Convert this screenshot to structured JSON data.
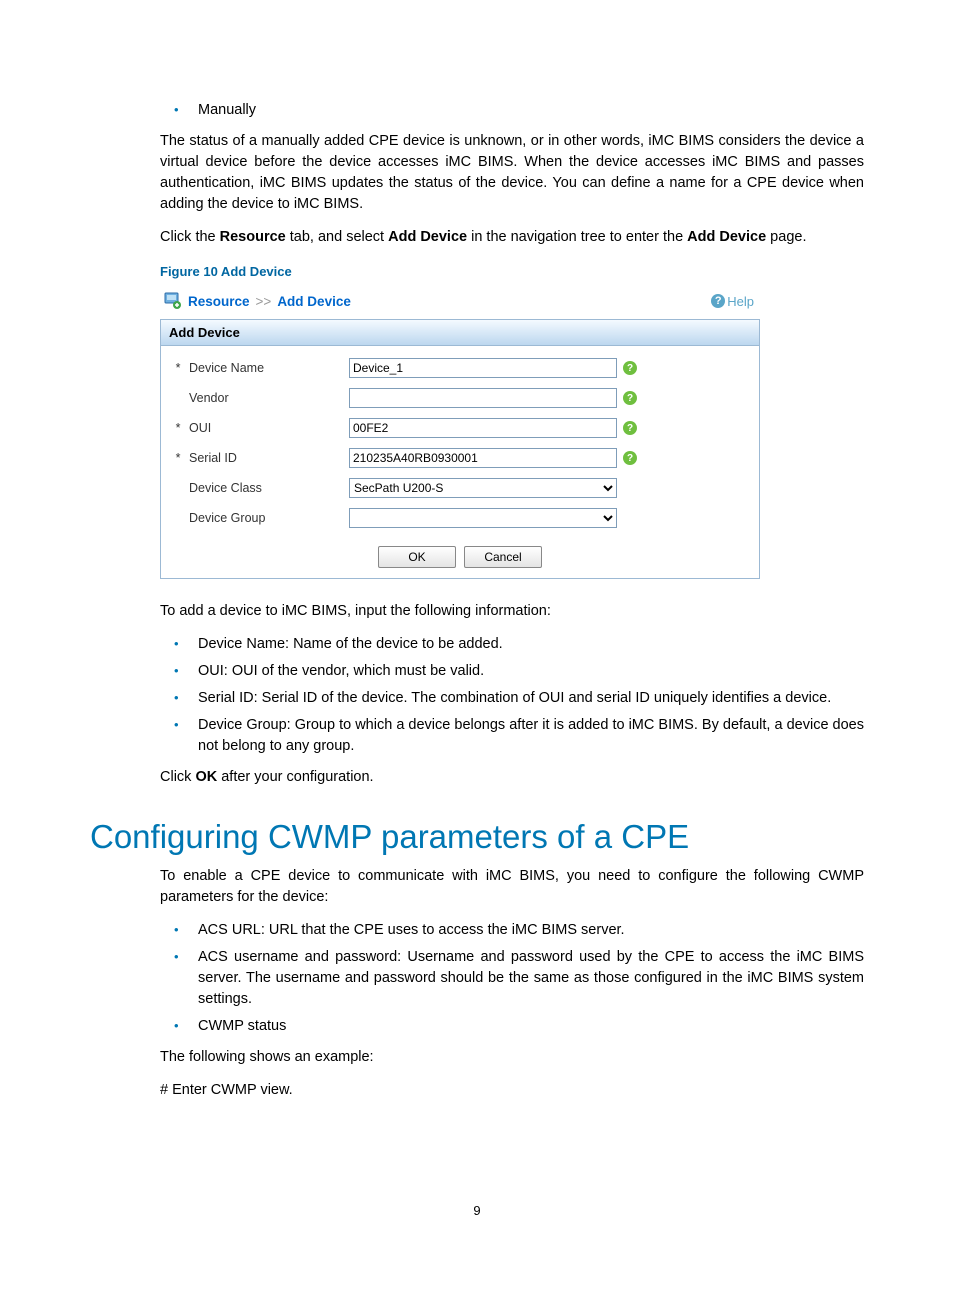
{
  "intro": {
    "bullet_manually": "Manually",
    "paragraph_status": "The status of a manually added CPE device is unknown, or in other words, iMC BIMS considers the device a virtual device before the device accesses iMC BIMS. When the device accesses iMC BIMS and passes authentication, iMC BIMS updates the status of the device. You can define a name for a CPE device when adding the device to iMC BIMS.",
    "click_text_1": "Click the ",
    "click_bold_1": "Resource",
    "click_text_2": " tab, and select ",
    "click_bold_2": "Add Device",
    "click_text_3": " in the navigation tree to enter the ",
    "click_bold_3": "Add Device",
    "click_text_4": " page.",
    "figure_caption": "Figure 10 Add Device"
  },
  "screenshot": {
    "breadcrumb_root": "Resource",
    "breadcrumb_sep": ">>",
    "breadcrumb_leaf": "Add Device",
    "help_label": "Help",
    "panel_title": "Add Device",
    "fields": {
      "device_name": {
        "label": "Device Name",
        "required": "*",
        "value": "Device_1"
      },
      "vendor": {
        "label": "Vendor",
        "required": "",
        "value": ""
      },
      "oui": {
        "label": "OUI",
        "required": "*",
        "value": "00FE2"
      },
      "serial_id": {
        "label": "Serial ID",
        "required": "*",
        "value": "210235A40RB0930001"
      },
      "device_class": {
        "label": "Device Class",
        "required": "",
        "value": "SecPath U200-S"
      },
      "device_group": {
        "label": "Device Group",
        "required": "",
        "value": ""
      }
    },
    "ok_label": "OK",
    "cancel_label": "Cancel"
  },
  "after_figure": {
    "intro_line": "To add a device to iMC BIMS, input the following information:",
    "bullets": [
      "Device Name: Name of the device to be added.",
      "OUI: OUI of the vendor, which must be valid.",
      "Serial ID: Serial ID of the device. The combination of OUI and serial ID uniquely identifies a device.",
      "Device Group: Group to which a device belongs after it is added to iMC BIMS. By default, a device does not belong to any group."
    ],
    "click_ok_1": "Click ",
    "click_ok_bold": "OK",
    "click_ok_2": " after your configuration."
  },
  "section2": {
    "heading": "Configuring CWMP parameters of a CPE",
    "intro": "To enable a CPE device to communicate with iMC BIMS, you need to configure the following CWMP parameters for the device:",
    "bullets": [
      "ACS URL: URL that the CPE uses to access the iMC BIMS server.",
      "ACS username and password: Username and password used by the CPE to access the iMC BIMS server. The username and password should be the same as those configured in the iMC BIMS system settings.",
      "CWMP status"
    ],
    "example_line": "The following shows an example:",
    "enter_view": "# Enter CWMP view."
  },
  "page_number": "9"
}
